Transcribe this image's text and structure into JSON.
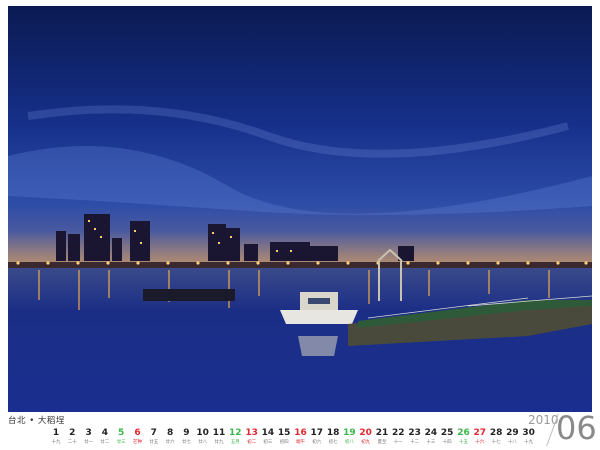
{
  "caption": "台北 • 大稻埕",
  "year": "2010",
  "month": "06",
  "colors": {
    "sunday": "#e3262f",
    "saturday": "#3ab54a",
    "weekday": "#222222"
  },
  "days": [
    {
      "num": "1",
      "lunar": "十九",
      "type": "weekday"
    },
    {
      "num": "2",
      "lunar": "二十",
      "type": "weekday"
    },
    {
      "num": "3",
      "lunar": "廿一",
      "type": "weekday"
    },
    {
      "num": "4",
      "lunar": "廿二",
      "type": "weekday"
    },
    {
      "num": "5",
      "lunar": "廿三",
      "type": "sat"
    },
    {
      "num": "6",
      "lunar": "芒种",
      "type": "sun"
    },
    {
      "num": "7",
      "lunar": "廿五",
      "type": "weekday"
    },
    {
      "num": "8",
      "lunar": "廿六",
      "type": "weekday"
    },
    {
      "num": "9",
      "lunar": "廿七",
      "type": "weekday"
    },
    {
      "num": "10",
      "lunar": "廿八",
      "type": "weekday"
    },
    {
      "num": "11",
      "lunar": "廿九",
      "type": "weekday"
    },
    {
      "num": "12",
      "lunar": "五月",
      "type": "sat"
    },
    {
      "num": "13",
      "lunar": "初二",
      "type": "sun"
    },
    {
      "num": "14",
      "lunar": "初三",
      "type": "weekday"
    },
    {
      "num": "15",
      "lunar": "初四",
      "type": "weekday"
    },
    {
      "num": "16",
      "lunar": "端午",
      "type": "sun"
    },
    {
      "num": "17",
      "lunar": "初六",
      "type": "weekday"
    },
    {
      "num": "18",
      "lunar": "初七",
      "type": "weekday"
    },
    {
      "num": "19",
      "lunar": "初八",
      "type": "sat"
    },
    {
      "num": "20",
      "lunar": "初九",
      "type": "sun"
    },
    {
      "num": "21",
      "lunar": "夏至",
      "type": "weekday"
    },
    {
      "num": "22",
      "lunar": "十一",
      "type": "weekday"
    },
    {
      "num": "23",
      "lunar": "十二",
      "type": "weekday"
    },
    {
      "num": "24",
      "lunar": "十三",
      "type": "weekday"
    },
    {
      "num": "25",
      "lunar": "十四",
      "type": "weekday"
    },
    {
      "num": "26",
      "lunar": "十五",
      "type": "sat"
    },
    {
      "num": "27",
      "lunar": "十六",
      "type": "sun"
    },
    {
      "num": "28",
      "lunar": "十七",
      "type": "weekday"
    },
    {
      "num": "29",
      "lunar": "十八",
      "type": "weekday"
    },
    {
      "num": "30",
      "lunar": "十九",
      "type": "weekday"
    }
  ]
}
